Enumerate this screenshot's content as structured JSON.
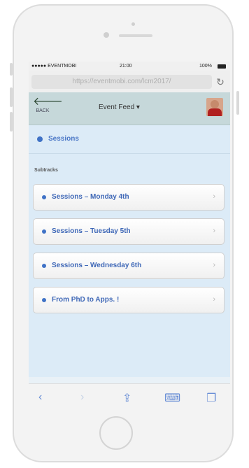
{
  "statusbar": {
    "carrier": "●●●●● EVENTMOBI",
    "time": "21:00",
    "battery": "100%"
  },
  "browser": {
    "url": "https://eventmobi.com/lcm2017/",
    "reload_icon": "reload-icon"
  },
  "navbar": {
    "back_label": "BACK",
    "title": "Event Feed ▾",
    "back_icon": "arrow-left-icon"
  },
  "content": {
    "section_title": "Sessions",
    "subtracks_label": "Subtracks",
    "items": [
      {
        "label": "Sessions – Monday 4th"
      },
      {
        "label": "Sessions – Tuesday 5th"
      },
      {
        "label": "Sessions – Wednesday 6th"
      },
      {
        "label": "From PhD to Apps. !"
      }
    ]
  },
  "toolbar": {
    "back": "‹",
    "forward": "›",
    "share": "⇪",
    "bookmarks": "⌨",
    "tabs": "❐"
  },
  "colors": {
    "accent": "#3f72c6",
    "navbar": "#c6d8da",
    "content_bg": "#dcebf7"
  }
}
